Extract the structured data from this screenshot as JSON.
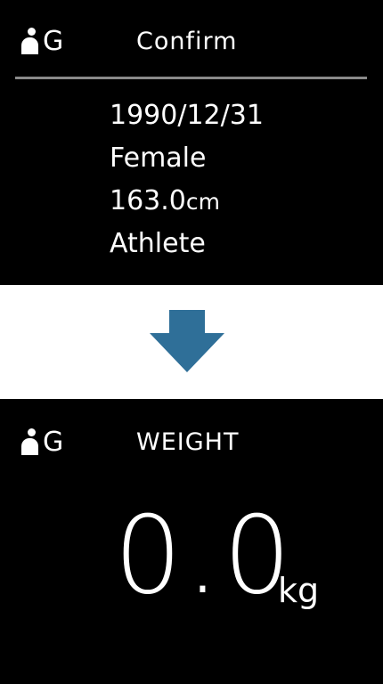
{
  "confirm_screen": {
    "user_letter": "G",
    "title": "Confirm",
    "birthdate": "1990/12/31",
    "gender": "Female",
    "height_value": "163.0",
    "height_unit": "cm",
    "activity": "Athlete"
  },
  "arrow": {
    "icon": "down-arrow-icon",
    "color": "#2f6f98"
  },
  "weight_screen": {
    "user_letter": "G",
    "title": "WEIGHT",
    "weight_value": "0.0",
    "weight_unit": "kg"
  },
  "colors": {
    "screen_bg": "#000000",
    "text": "#ffffff",
    "divider": "#8a8a8a"
  }
}
